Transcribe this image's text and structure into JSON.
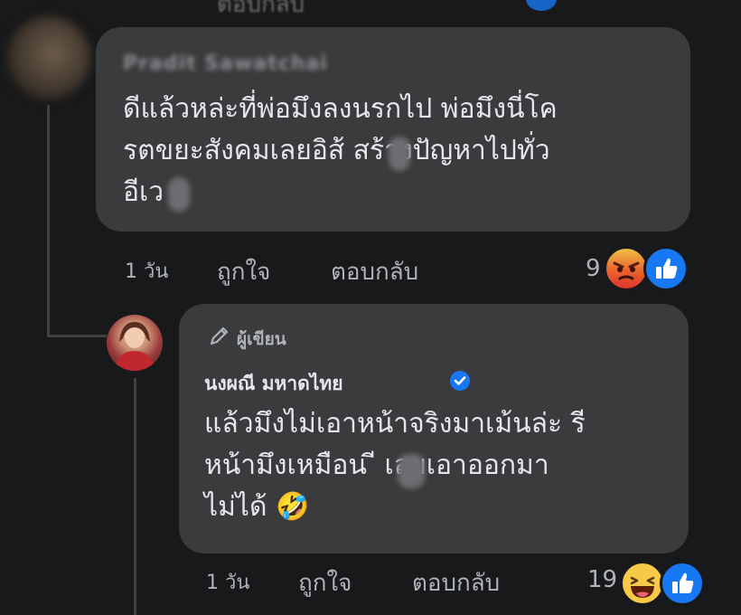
{
  "top_row": {
    "actions": "ตอบกลับ"
  },
  "comment1": {
    "author": "Pradit Sawatchai",
    "text": "ดีแล้วหล่ะที่พ่อมึงลงนรกไป พ่อมึงนี่โค\nรตขยะสังคมเลยอิส้   สร้างปัญหาไปทั่ว\nอีเว",
    "time": "1 วัน",
    "like_label": "ถูกใจ",
    "reply_label": "ตอบกลับ",
    "reaction_count": "9",
    "reactions": [
      "angry-icon",
      "like-icon"
    ]
  },
  "comment2": {
    "author_badge": "ผู้เขียน",
    "author": "นงผณี มหาดไทย",
    "text": "แล้วมึงไม่เอาหน้าจริงมาเม้นล่ะ รี\nหน้ามึงเหมือน   ี เลยเอาออกมา\nไม่ได้ 🤣",
    "time": "1 วัน",
    "like_label": "ถูกใจ",
    "reply_label": "ตอบกลับ",
    "reaction_count": "19",
    "reactions": [
      "haha-icon",
      "like-icon"
    ]
  },
  "colors": {
    "background": "#18191a",
    "bubble": "#3a3b3c",
    "primary_text": "#e4e6eb",
    "secondary_text": "#b0b3b8",
    "like_blue": "#1877f2"
  }
}
